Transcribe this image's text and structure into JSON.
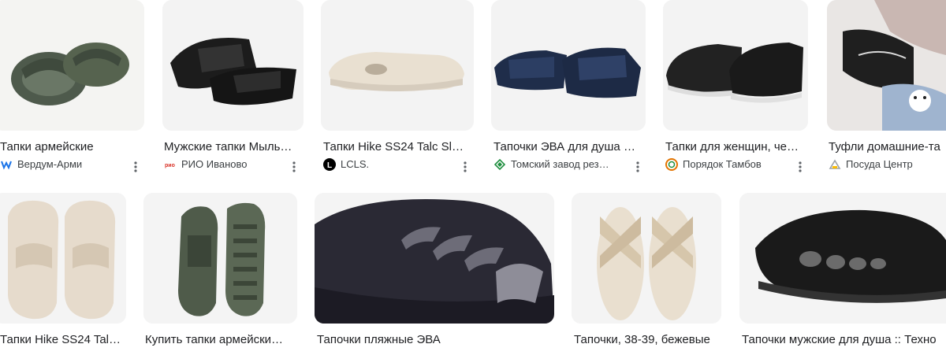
{
  "row1": [
    {
      "title": "Тапки армейские",
      "source": "Вердум-Арми",
      "fav": "verdum-favicon",
      "fav_color": "#1a73e8"
    },
    {
      "title": "Мужские тапки Мыль…",
      "source": "РИО Иваново",
      "fav": "rio-favicon",
      "fav_color": "#d93025"
    },
    {
      "title": "Тапки Hike SS24 Talc Sl…",
      "source": "LCLS.",
      "fav": "lcls-favicon",
      "fav_color": "#000000"
    },
    {
      "title": "Тапочки ЭВА для душа …",
      "source": "Томский завод рез…",
      "fav": "tomsk-favicon",
      "fav_color": "#1e8e3e"
    },
    {
      "title": "Тапки для женщин, че…",
      "source": "Порядок Тамбов",
      "fav": "poryadok-favicon",
      "fav_color": "#e37400"
    },
    {
      "title": "Туфли домашние-та",
      "source": "Посуда Центр",
      "fav": "posuda-favicon",
      "fav_color": "#9aa0a6"
    }
  ],
  "row2": [
    {
      "title": "Тапки Hike SS24 Tal…"
    },
    {
      "title": "Купить тапки армейски…"
    },
    {
      "title": "Тапочки пляжные ЭВА"
    },
    {
      "title": "Тапочки, 38-39, бежевые"
    },
    {
      "title": "Тапочки мужские для душа :: Техно"
    }
  ],
  "colors": {
    "thumb_bg": "#f1f3f4",
    "text": "#202124",
    "source": "#3c4043",
    "icon": "#5f6368"
  }
}
